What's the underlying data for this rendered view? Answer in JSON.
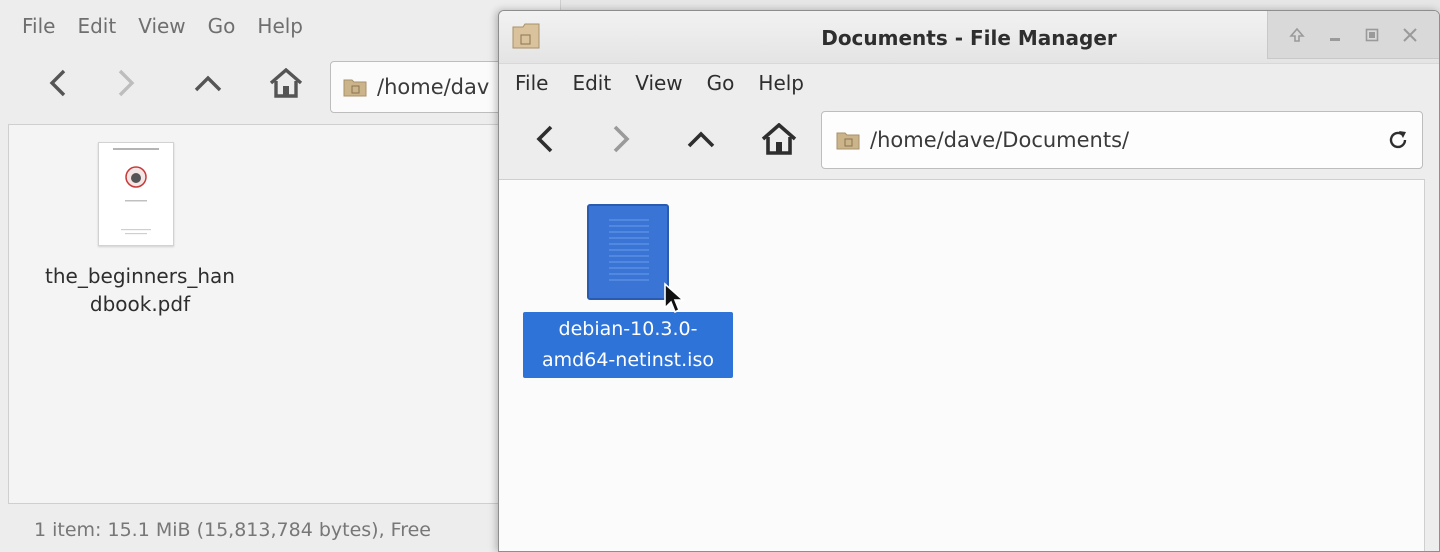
{
  "background_window": {
    "menu": [
      "File",
      "Edit",
      "View",
      "Go",
      "Help"
    ],
    "path": "/home/dav",
    "file": {
      "name_line1": "the_beginners_han",
      "name_line2": "dbook.pdf"
    },
    "status": "1 item: 15.1 MiB (15,813,784 bytes), Free"
  },
  "foreground_window": {
    "title": "Documents - File Manager",
    "menu": [
      "File",
      "Edit",
      "View",
      "Go",
      "Help"
    ],
    "path": "/home/dave/Documents/",
    "file": {
      "name_line1": "debian-10.3.0-",
      "name_line2": "amd64-netinst.iso",
      "selected": true
    }
  },
  "colors": {
    "selection": "#2e73d8",
    "icon_blue": "#3a75d6"
  },
  "icons": [
    "back-icon",
    "forward-icon",
    "up-icon",
    "home-icon",
    "folder-icon",
    "reload-icon",
    "sticky-icon",
    "minimize-icon",
    "maximize-icon",
    "close-icon",
    "mouse-cursor-icon"
  ]
}
